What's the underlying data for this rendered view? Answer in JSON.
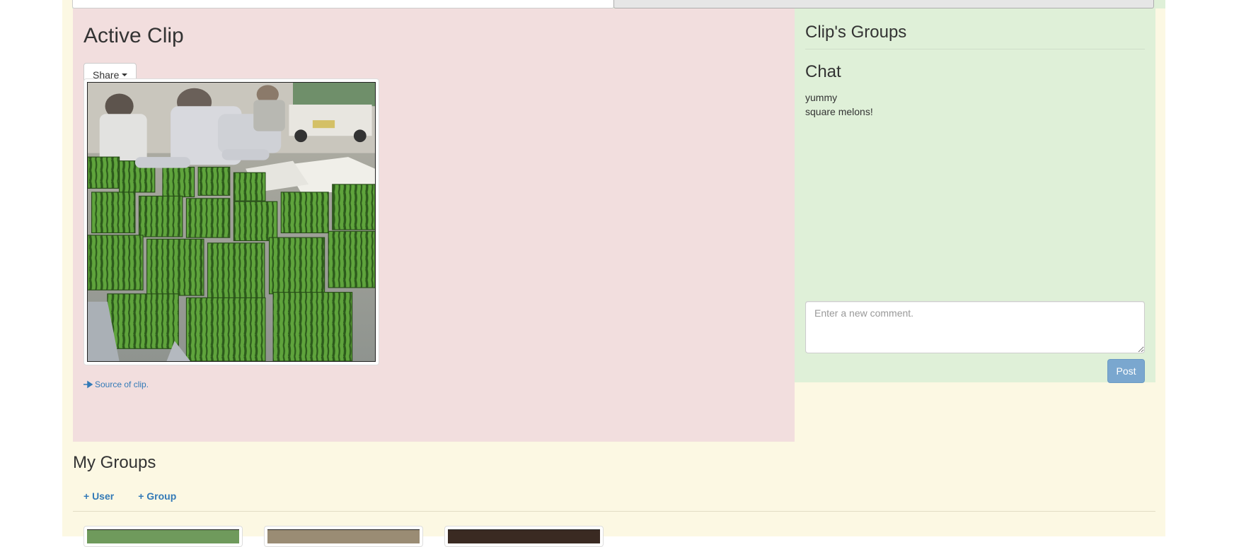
{
  "active_clip": {
    "title": "Active Clip",
    "share_label": "Share",
    "image_alt": "square watermelons being arranged on a table",
    "source_label": "Source of clip."
  },
  "clip_groups": {
    "title": "Clip's Groups",
    "chat_title": "Chat",
    "messages": [
      "yummy",
      "square melons!"
    ],
    "comment_placeholder": "Enter a new comment.",
    "post_label": "Post"
  },
  "my_groups": {
    "title": "My Groups",
    "add_user_label": "+ User",
    "add_group_label": "+ Group"
  },
  "colors": {
    "page_bg": "#fcf8e3",
    "active_panel_bg": "#f2dede",
    "groups_panel_bg": "#dff0d8",
    "link": "#337ab7",
    "post_button": "#7aa7cf"
  }
}
